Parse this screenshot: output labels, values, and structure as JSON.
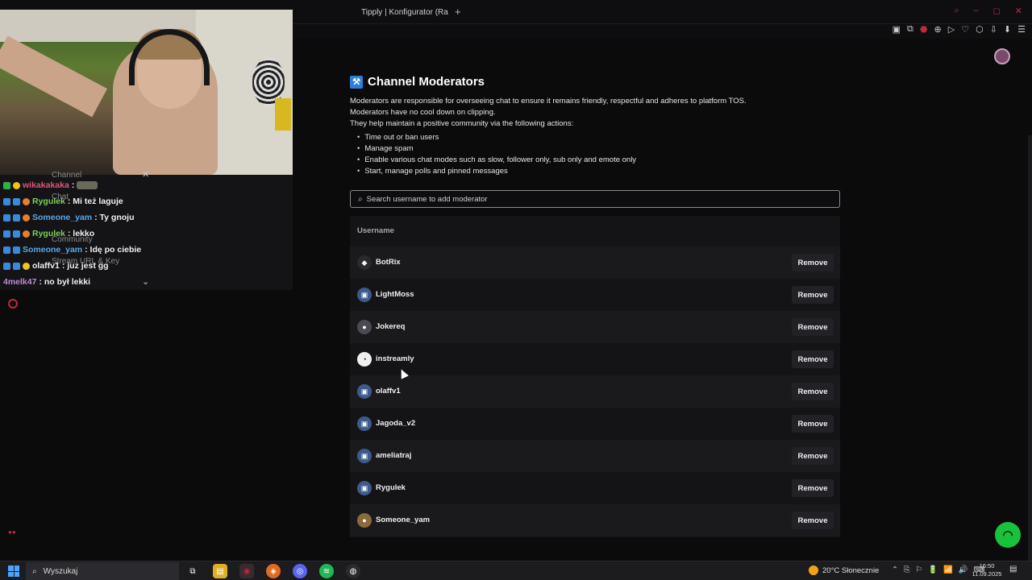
{
  "browser": {
    "tabs": [
      {
        "label": "Tipply | Konfigurator (Ran",
        "color": "#3a7bd5"
      }
    ],
    "new_tab": "+",
    "window_controls": [
      "⌕",
      "–",
      "◻",
      "✕"
    ],
    "toolbar_icons": [
      "▣",
      "⧉",
      "⬣",
      "⊕",
      "▷",
      "♡",
      "⬡",
      "⇩",
      "⬇",
      "☰"
    ]
  },
  "chat": {
    "ghost_labels": [
      "Channel",
      "Chat",
      "Community",
      "Stream URL & Key"
    ],
    "messages": [
      {
        "user": "wikakakaka",
        "user_color": "#e0577a",
        "text": ":",
        "badges": [
          "#2bb34a",
          "#f1c21b"
        ]
      },
      {
        "user": "Rygulek",
        "user_color": "#7ad05a",
        "text": ": Mi też laguje",
        "badges": [
          "#3a8ad8",
          "#3a8ad8",
          "#e08030"
        ]
      },
      {
        "user": "Someone_yam",
        "user_color": "#5aa8e8",
        "text": ": Ty gnoju",
        "badges": [
          "#3a8ad8",
          "#3a8ad8",
          "#e08030"
        ]
      },
      {
        "user": "Rygulek",
        "user_color": "#7ad05a",
        "text": ": lekko",
        "badges": [
          "#3a8ad8",
          "#3a8ad8",
          "#e08030"
        ]
      },
      {
        "user": "Someone_yam",
        "user_color": "#5aa8e8",
        "text": ": Idę po ciebie",
        "badges": [
          "#3a8ad8",
          "#3a8ad8",
          "#e08030"
        ]
      },
      {
        "user": "olaffv1",
        "user_color": "#f0f0f0",
        "text": ": juz jest gg",
        "badges": [
          "#3a8ad8",
          "#3a8ad8",
          "#f1c21b"
        ]
      },
      {
        "user": "4melk47",
        "user_color": "#c08ad8",
        "text": ": no był lekki",
        "badges": []
      }
    ]
  },
  "page": {
    "title": "Channel Moderators",
    "description": [
      "Moderators are responsible for overseeing chat to ensure it remains friendly, respectful and adheres to platform TOS.",
      "Moderators have no cool down on clipping.",
      "They help maintain a positive community via the following actions:"
    ],
    "bullets": [
      "Time out or ban users",
      "Manage spam",
      "Enable various chat modes such as slow, follower only, sub only and emote only",
      "Start, manage polls and pinned messages"
    ],
    "search": {
      "placeholder": "Search username to add moderator"
    },
    "table": {
      "header": "Username",
      "remove_label": "Remove",
      "rows": [
        {
          "username": "BotRix",
          "icon": "◆",
          "icon_bg": "#2a2a2e"
        },
        {
          "username": "LightMoss",
          "icon": "▣",
          "icon_bg": "#3d5a8a"
        },
        {
          "username": "Jokereq",
          "icon": "●",
          "icon_bg": "#4a4a52"
        },
        {
          "username": "instreamly",
          "icon": "◔",
          "icon_bg": "#f0f0f0"
        },
        {
          "username": "olaffv1",
          "icon": "▣",
          "icon_bg": "#3d5a8a"
        },
        {
          "username": "Jagoda_v2",
          "icon": "▣",
          "icon_bg": "#3d5a8a"
        },
        {
          "username": "ameliatraj",
          "icon": "▣",
          "icon_bg": "#3d5a8a"
        },
        {
          "username": "Rygulek",
          "icon": "▣",
          "icon_bg": "#3d5a8a"
        },
        {
          "username": "Someone_yam",
          "icon": "●",
          "icon_bg": "#8a6a3a"
        }
      ]
    }
  },
  "taskbar": {
    "search_label": "Wyszukaj",
    "weather": "20°C Słonecznie",
    "time": "16:50",
    "date": "11.09.2025",
    "apps": [
      {
        "name": "task-view",
        "glyph": "⧉",
        "color": "#2a2a2e"
      },
      {
        "name": "file-explorer",
        "glyph": "▤",
        "color": "#e0b020"
      },
      {
        "name": "browser",
        "glyph": "◉",
        "color": "#c0283c"
      },
      {
        "name": "brave",
        "glyph": "◈",
        "color": "#e06a20"
      },
      {
        "name": "discord",
        "glyph": "◎",
        "color": "#5865f2"
      },
      {
        "name": "spotify",
        "glyph": "≋",
        "color": "#1db954"
      },
      {
        "name": "obs",
        "glyph": "◍",
        "color": "#2a2a2e"
      }
    ],
    "tray_icons": [
      "⌃",
      "⎘",
      "⚐",
      "🔋",
      "📶",
      "🔊",
      "⌨"
    ]
  }
}
